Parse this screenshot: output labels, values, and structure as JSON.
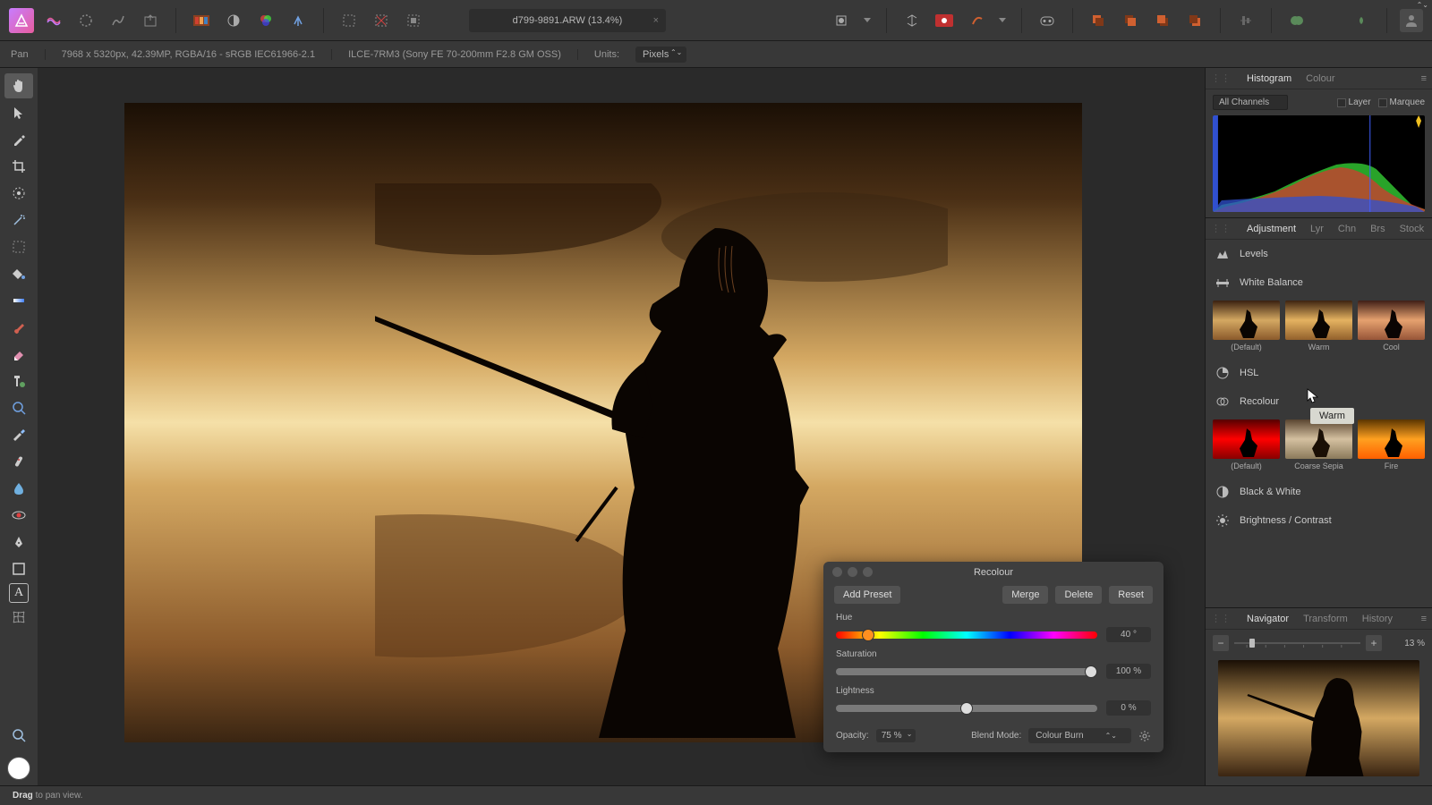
{
  "doc_title": "d799-9891.ARW (13.4%)",
  "context": {
    "tool": "Pan",
    "dims": "7968 x 5320px, 42.39MP, RGBA/16 - sRGB IEC61966-2.1",
    "camera": "ILCE-7RM3 (Sony FE 70-200mm F2.8 GM OSS)",
    "units_label": "Units:",
    "units_value": "Pixels"
  },
  "panels": {
    "histogram_tab": "Histogram",
    "colour_tab": "Colour",
    "channels_label": "All Channels",
    "layer_check": "Layer",
    "marquee_check": "Marquee",
    "adjustment_tab": "Adjustment",
    "lyr_tab": "Lyr",
    "chn_tab": "Chn",
    "brs_tab": "Brs",
    "stock_tab": "Stock",
    "levels": "Levels",
    "white_balance": "White Balance",
    "wb_presets": {
      "default": "(Default)",
      "warm": "Warm",
      "cool": "Cool"
    },
    "hsl": "HSL",
    "recolour": "Recolour",
    "rc_presets": {
      "default": "(Default)",
      "sepia": "Coarse Sepia",
      "fire": "Fire"
    },
    "bw": "Black & White",
    "bc": "Brightness / Contrast",
    "navigator_tab": "Navigator",
    "transform_tab": "Transform",
    "history_tab": "History",
    "zoom_value": "13 %"
  },
  "tooltip": "Warm",
  "dialog": {
    "title": "Recolour",
    "add_preset": "Add Preset",
    "merge": "Merge",
    "delete": "Delete",
    "reset": "Reset",
    "hue_label": "Hue",
    "hue_value": "40 °",
    "sat_label": "Saturation",
    "sat_value": "100 %",
    "light_label": "Lightness",
    "light_value": "0 %",
    "opacity_label": "Opacity:",
    "opacity_value": "75 %",
    "blend_label": "Blend Mode:",
    "blend_value": "Colour Burn"
  },
  "status": {
    "bold": "Drag",
    "rest": " to pan view."
  }
}
